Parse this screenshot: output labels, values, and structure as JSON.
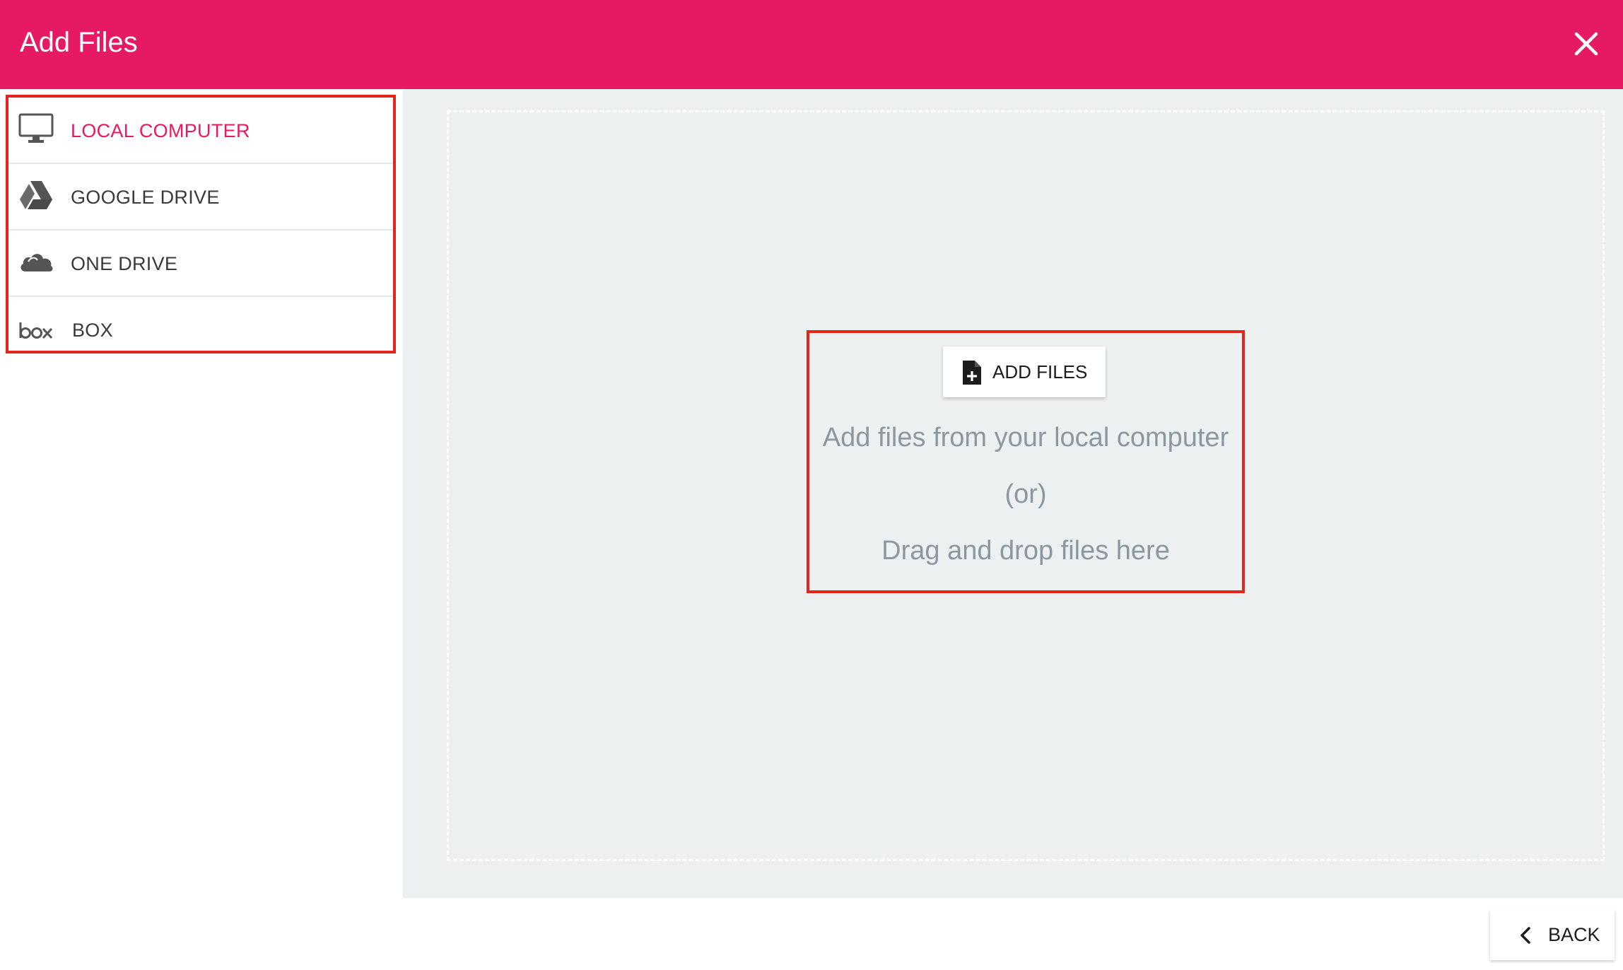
{
  "header": {
    "title": "Add Files",
    "close_icon": "close-icon",
    "background_color": "#e61964"
  },
  "sources": {
    "items": [
      {
        "label": "LOCAL COMPUTER",
        "icon": "monitor-icon",
        "active": true
      },
      {
        "label": "GOOGLE DRIVE",
        "icon": "google-drive-icon",
        "active": false
      },
      {
        "label": "ONE DRIVE",
        "icon": "onedrive-cloud-icon",
        "active": false
      },
      {
        "label": "BOX",
        "icon": "box-logo-icon",
        "active": false
      }
    ],
    "active_color": "#e61964"
  },
  "dropzone": {
    "button_label": "ADD FILES",
    "button_icon": "file-add-icon",
    "hint_line1": "Add files from your local computer",
    "hint_line2": "(or)",
    "hint_line3": "Drag and drop files here"
  },
  "footer": {
    "back_label": "BACK",
    "back_icon": "chevron-left-icon"
  },
  "annotation_color": "#e3261d"
}
